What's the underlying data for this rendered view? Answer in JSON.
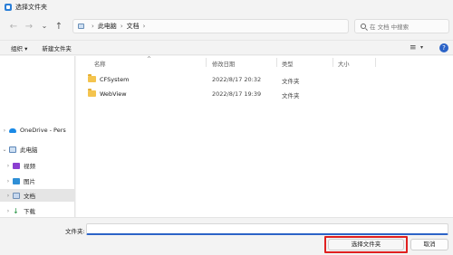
{
  "window": {
    "title": "选择文件夹"
  },
  "nav": {
    "back": "←",
    "forward": "→",
    "dropdown": "⌄",
    "up": "↑"
  },
  "address": {
    "breadcrumb": [
      "此电脑",
      "文档"
    ],
    "sep": "›"
  },
  "search": {
    "placeholder": "在 文档 中搜索"
  },
  "commands": {
    "organize": "组织 ▾",
    "new_folder": "新建文件夹"
  },
  "sidebar": {
    "items": [
      {
        "label": "OneDrive - Pers",
        "icon": "cloud-icon",
        "expand": "›"
      },
      {
        "label": "此电脑",
        "icon": "computer-icon",
        "expand": "⌄"
      },
      {
        "label": "视频",
        "icon": "video-icon",
        "expand": "›"
      },
      {
        "label": "图片",
        "icon": "picture-icon",
        "expand": "›"
      },
      {
        "label": "文档",
        "icon": "document-icon",
        "expand": "›"
      },
      {
        "label": "下载",
        "icon": "download-icon",
        "expand": "›"
      }
    ]
  },
  "columns": {
    "name": "名称",
    "modified": "修改日期",
    "type": "类型",
    "size": "大小"
  },
  "files": [
    {
      "name": "CFSystem",
      "modified": "2022/8/17 20:32",
      "type": "文件夹"
    },
    {
      "name": "WebView",
      "modified": "2022/8/17 19:39",
      "type": "文件夹"
    }
  ],
  "footer": {
    "filename_label": "文件夹:",
    "filename_value": "",
    "select_label": "选择文件夹",
    "cancel_label": "取消"
  }
}
